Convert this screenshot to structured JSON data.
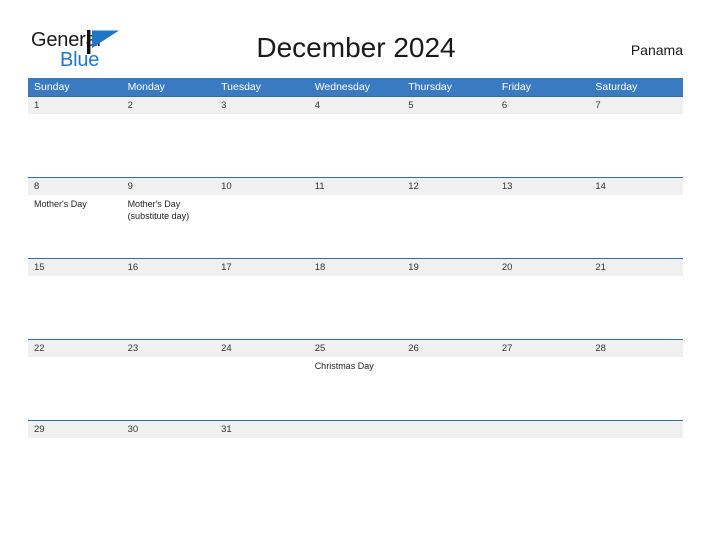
{
  "brand": {
    "name_part1": "General",
    "name_part2": "Blue",
    "flag_icon": "flag-icon",
    "accent_color": "#1f77c4",
    "text_color": "#1a1a1a"
  },
  "header": {
    "title": "December 2024",
    "country": "Panama"
  },
  "theme": {
    "header_bar_color": "#3a7ac0",
    "date_band_color": "#f0f0f0",
    "row_border_color": "#2c6cb0",
    "page_background": "#ffffff"
  },
  "calendar": {
    "month": "December",
    "year": "2024",
    "weekday_headers": [
      "Sunday",
      "Monday",
      "Tuesday",
      "Wednesday",
      "Thursday",
      "Friday",
      "Saturday"
    ],
    "weeks": [
      {
        "days": [
          {
            "date": "1",
            "events": []
          },
          {
            "date": "2",
            "events": []
          },
          {
            "date": "3",
            "events": []
          },
          {
            "date": "4",
            "events": []
          },
          {
            "date": "5",
            "events": []
          },
          {
            "date": "6",
            "events": []
          },
          {
            "date": "7",
            "events": []
          }
        ]
      },
      {
        "days": [
          {
            "date": "8",
            "events": [
              "Mother's Day"
            ]
          },
          {
            "date": "9",
            "events": [
              "Mother's Day (substitute day)"
            ]
          },
          {
            "date": "10",
            "events": []
          },
          {
            "date": "11",
            "events": []
          },
          {
            "date": "12",
            "events": []
          },
          {
            "date": "13",
            "events": []
          },
          {
            "date": "14",
            "events": []
          }
        ]
      },
      {
        "days": [
          {
            "date": "15",
            "events": []
          },
          {
            "date": "16",
            "events": []
          },
          {
            "date": "17",
            "events": []
          },
          {
            "date": "18",
            "events": []
          },
          {
            "date": "19",
            "events": []
          },
          {
            "date": "20",
            "events": []
          },
          {
            "date": "21",
            "events": []
          }
        ]
      },
      {
        "days": [
          {
            "date": "22",
            "events": []
          },
          {
            "date": "23",
            "events": []
          },
          {
            "date": "24",
            "events": []
          },
          {
            "date": "25",
            "events": [
              "Christmas Day"
            ]
          },
          {
            "date": "26",
            "events": []
          },
          {
            "date": "27",
            "events": []
          },
          {
            "date": "28",
            "events": []
          }
        ]
      },
      {
        "days": [
          {
            "date": "29",
            "events": []
          },
          {
            "date": "30",
            "events": []
          },
          {
            "date": "31",
            "events": []
          },
          {
            "date": "",
            "events": []
          },
          {
            "date": "",
            "events": []
          },
          {
            "date": "",
            "events": []
          },
          {
            "date": "",
            "events": []
          }
        ]
      }
    ]
  }
}
